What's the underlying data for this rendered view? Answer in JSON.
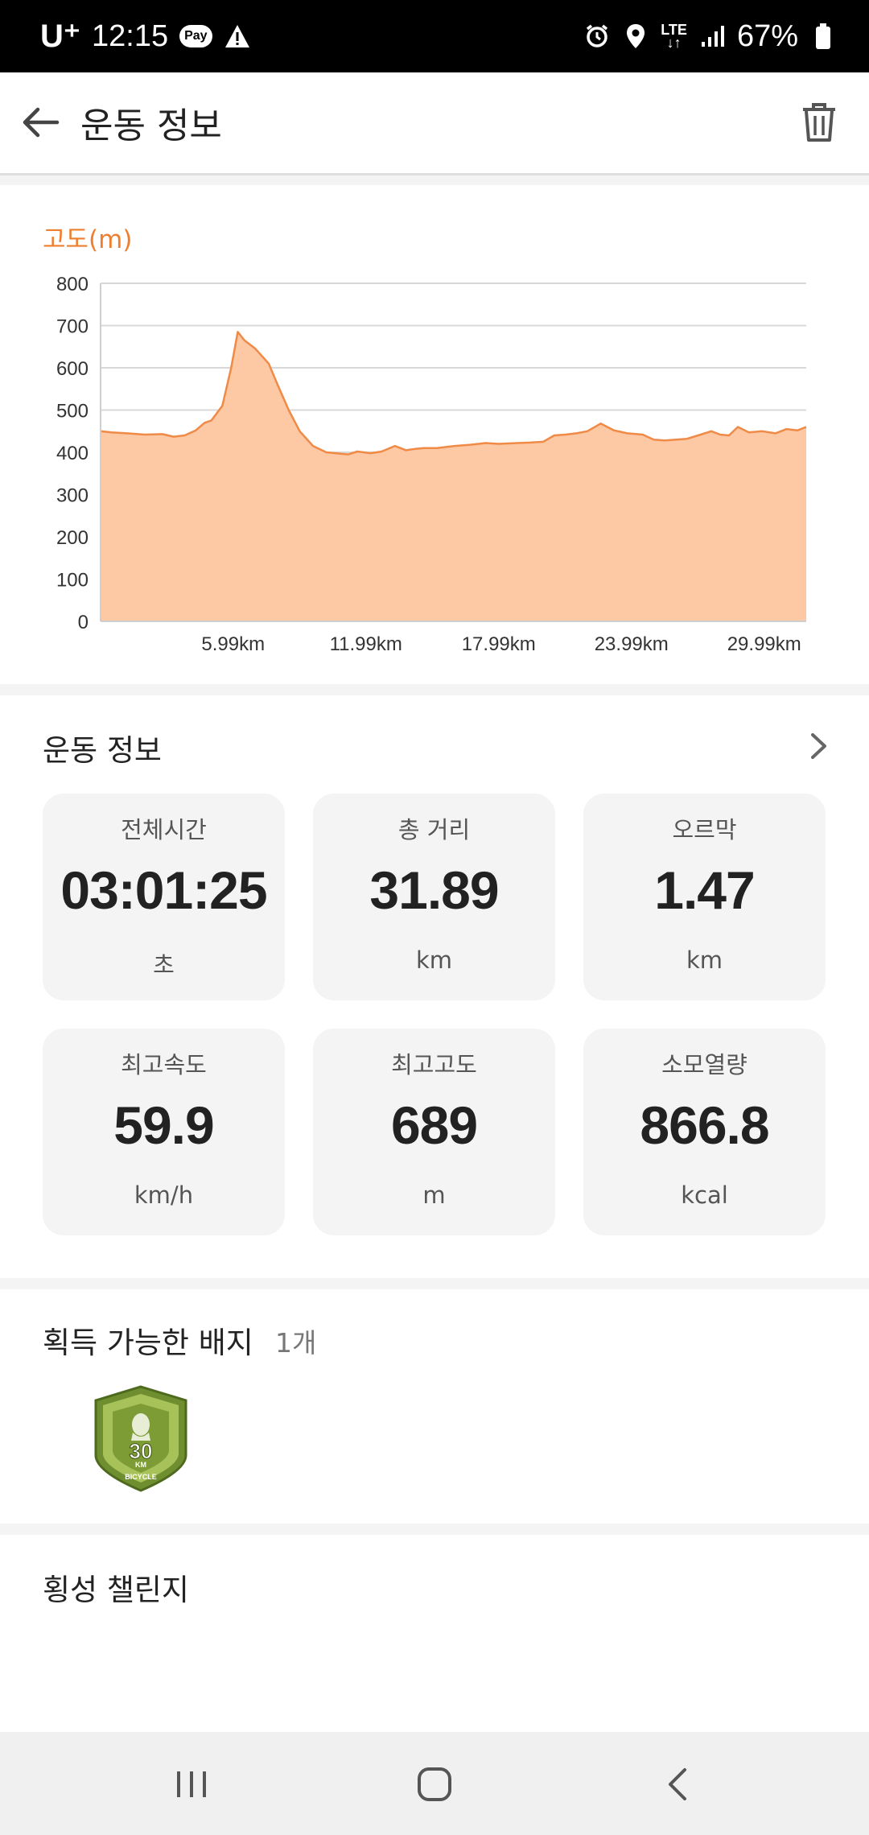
{
  "status_bar": {
    "carrier": "U⁺",
    "time": "12:15",
    "pay_label": "Pay",
    "network": "LTE",
    "battery": "67%"
  },
  "app_bar": {
    "title": "운동 정보",
    "icons": [
      "back-arrow-icon",
      "trash-icon"
    ]
  },
  "elevation_chart": {
    "title": "고도(m)"
  },
  "chart_data": {
    "type": "area",
    "title": "고도(m)",
    "xlabel": "",
    "ylabel": "고도(m)",
    "ylim": [
      0,
      800
    ],
    "xlim": [
      0,
      31.89
    ],
    "y_ticks": [
      "800",
      "700",
      "600",
      "500",
      "400",
      "300",
      "200",
      "100",
      "0"
    ],
    "x_ticks": [
      "5.99km",
      "11.99km",
      "17.99km",
      "23.99km",
      "29.99km"
    ],
    "x_tick_values": [
      5.99,
      11.99,
      17.99,
      23.99,
      29.99
    ],
    "grid": true,
    "fill_color": "#fdc8a4",
    "line_color": "#ef8a47",
    "series": [
      {
        "x": [
          0,
          0.5,
          1.2,
          2.0,
          2.8,
          3.3,
          3.8,
          4.3,
          4.7,
          5.0,
          5.5,
          5.9,
          6.2,
          6.5,
          7.0,
          7.6,
          8.0,
          8.5,
          9.0,
          9.6,
          10.2,
          10.8,
          11.2,
          11.6,
          12.2,
          12.7,
          13.3,
          13.8,
          14.2,
          14.6,
          15.2,
          16.0,
          16.7,
          17.4,
          18.0,
          18.8,
          19.4,
          20.0,
          20.5,
          21.0,
          21.5,
          22.0,
          22.6,
          23.2,
          23.8,
          24.5,
          25.0,
          25.5,
          26.0,
          26.5,
          27.0,
          27.6,
          28.0,
          28.4,
          28.8,
          29.3,
          29.9,
          30.5,
          31.0,
          31.5,
          31.89
        ],
        "y": [
          450,
          447,
          445,
          442,
          443,
          437,
          440,
          452,
          470,
          475,
          510,
          600,
          685,
          665,
          645,
          610,
          560,
          500,
          450,
          415,
          400,
          397,
          395,
          402,
          398,
          402,
          415,
          405,
          408,
          410,
          410,
          415,
          418,
          422,
          420,
          422,
          423,
          425,
          440,
          442,
          445,
          450,
          468,
          452,
          445,
          442,
          430,
          428,
          430,
          432,
          440,
          450,
          442,
          440,
          460,
          447,
          450,
          445,
          455,
          452,
          460
        ]
      }
    ]
  },
  "workout_section": {
    "title": "운동 정보",
    "stats": [
      {
        "label": "전체시간",
        "value": "03:01:25",
        "unit": "초"
      },
      {
        "label": "총 거리",
        "value": "31.89",
        "unit": "km"
      },
      {
        "label": "오르막",
        "value": "1.47",
        "unit": "km"
      },
      {
        "label": "최고속도",
        "value": "59.9",
        "unit": "km/h"
      },
      {
        "label": "최고고도",
        "value": "689",
        "unit": "m"
      },
      {
        "label": "소모열량",
        "value": "866.8",
        "unit": "kcal"
      }
    ]
  },
  "badges_section": {
    "title": "획득 가능한 배지",
    "count": "1개",
    "badge": {
      "icon": "bicycle-30km-badge-icon",
      "number": "30",
      "unit": "KM",
      "caption": "BICYCLE",
      "color": "#7a9a3a"
    }
  },
  "challenge_section": {
    "title": "횡성 챌린지"
  },
  "nav_bar": {
    "icons": [
      "recent-apps-icon",
      "home-icon",
      "back-icon"
    ]
  }
}
